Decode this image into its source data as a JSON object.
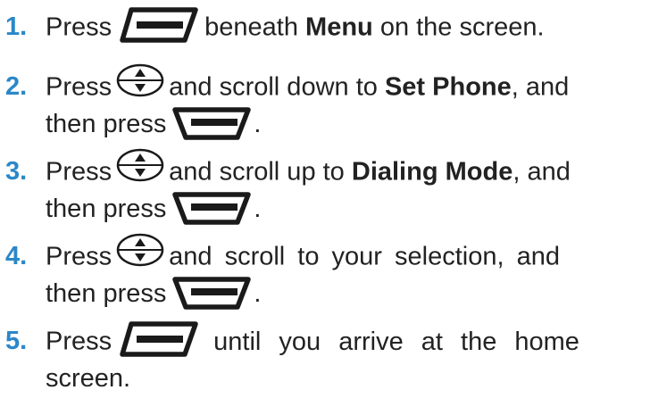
{
  "colors": {
    "step_number": "#2b87c8",
    "text": "#222222",
    "icon": "#1a1a1a"
  },
  "icons": {
    "left_soft_key": "left-soft-key-icon",
    "right_soft_key": "right-soft-key-icon",
    "nav_key": "up-down-navigation-key-icon"
  },
  "steps": [
    {
      "number": "1.",
      "press": "Press",
      "after_icon": "beneath",
      "bold": "Menu",
      "end": "on the screen."
    },
    {
      "number": "2.",
      "press": "Press",
      "after_icon": "and scroll down to",
      "bold": "Set Phone",
      "end": ", and",
      "line2": "then press",
      "period": "."
    },
    {
      "number": "3.",
      "press": "Press",
      "after_icon": "and scroll up to",
      "bold": "Dialing Mode",
      "end": ", and",
      "line2": "then press",
      "period": "."
    },
    {
      "number": "4.",
      "press": "Press",
      "after_icon": "and scroll to your selection, and",
      "line2": "then press",
      "period": "."
    },
    {
      "number": "5.",
      "press": "Press",
      "after_icon": "until you arrive at the home",
      "line2": "screen."
    }
  ]
}
